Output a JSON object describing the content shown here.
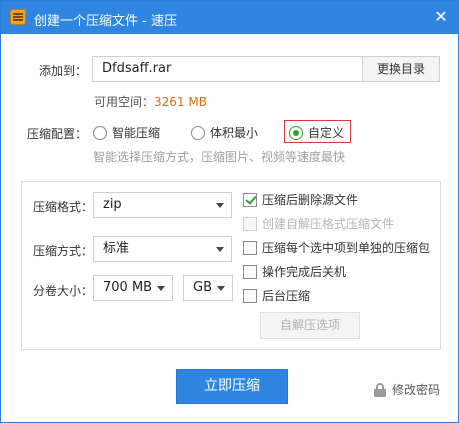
{
  "titlebar": {
    "title": "创建一个压缩文件 - 速压",
    "close_glyph": "✕",
    "icon": "archive-app-icon"
  },
  "add_to": {
    "label": "添加到：",
    "filename": "Dfdsaff.rar",
    "browse_label": "更换目录",
    "space_label": "可用空间：",
    "space_value": "3261 MB"
  },
  "compress_config": {
    "label": "压缩配置：",
    "options": [
      {
        "label": "智能压缩",
        "checked": false
      },
      {
        "label": "体积最小",
        "checked": false
      },
      {
        "label": "自定义",
        "checked": true
      }
    ],
    "hint": "智能选择压缩方式，压缩图片、视频等速度最快"
  },
  "settings": {
    "format_label": "压缩格式：",
    "format_value": "zip",
    "method_label": "压缩方式：",
    "method_value": "标准",
    "split_label": "分卷大小：",
    "split_value": "700 MB",
    "split_unit": "GB"
  },
  "options": [
    {
      "label": "压缩后删除源文件",
      "checked": true,
      "disabled": false
    },
    {
      "label": "创建自解压格式压缩文件",
      "checked": false,
      "disabled": true
    },
    {
      "label": "压缩每个选中项到单独的压缩包",
      "checked": false,
      "disabled": false
    },
    {
      "label": "操作完成后关机",
      "checked": false,
      "disabled": false
    },
    {
      "label": "后台压缩",
      "checked": false,
      "disabled": false
    }
  ],
  "sfx_options_label": "自解压选项",
  "actions": {
    "compress_label": "立即压缩",
    "password_label": "修改密码"
  },
  "colors": {
    "accent": "#2f86e0",
    "space_value": "#e86a13",
    "radio_checked": "#2ea02e",
    "highlight_box": "#d93a3a"
  }
}
